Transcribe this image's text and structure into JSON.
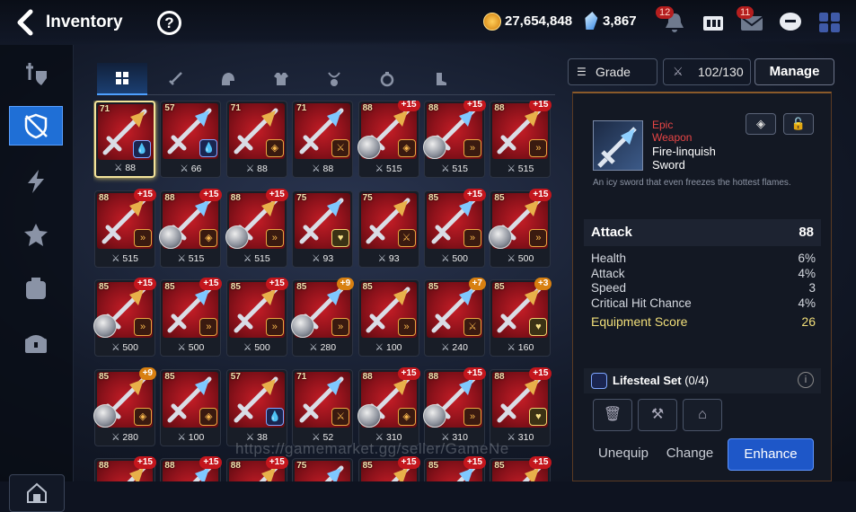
{
  "header": {
    "title": "Inventory",
    "help": "?",
    "gold": "27,654,848",
    "crystals": "3,867",
    "notif_badge": "12",
    "mail_badge": "11"
  },
  "sidebar": {
    "items": [
      "shield-slash-icon",
      "weapon-icon",
      "lightning-icon",
      "artifact-icon",
      "materials-icon",
      "chest-icon"
    ],
    "bottom": "house-icon"
  },
  "tabs": [
    "all",
    "weapon",
    "helmet",
    "armor",
    "necklace",
    "ring",
    "boots"
  ],
  "toolbar": {
    "grade": "Grade",
    "count": "102/130",
    "manage": "Manage"
  },
  "items": [
    [
      {
        "lvl": "71",
        "plus": "",
        "stat": "88",
        "set": "💧",
        "setc": "blue",
        "hero": false,
        "sel": true
      },
      {
        "lvl": "57",
        "plus": "",
        "stat": "66",
        "set": "💧",
        "setc": "blue",
        "hero": false
      },
      {
        "lvl": "71",
        "plus": "",
        "stat": "88",
        "set": "◈",
        "setc": "",
        "hero": false
      },
      {
        "lvl": "71",
        "plus": "",
        "stat": "88",
        "set": "⚔",
        "setc": "",
        "hero": false
      },
      {
        "lvl": "88",
        "plus": "+15",
        "stat": "515",
        "set": "◈",
        "setc": "",
        "hero": true
      },
      {
        "lvl": "88",
        "plus": "+15",
        "stat": "515",
        "set": "»",
        "setc": "",
        "hero": true
      },
      {
        "lvl": "88",
        "plus": "+15",
        "stat": "515",
        "set": "»",
        "setc": "",
        "hero": false
      }
    ],
    [
      {
        "lvl": "88",
        "plus": "+15",
        "stat": "515",
        "set": "»",
        "setc": "",
        "hero": false
      },
      {
        "lvl": "88",
        "plus": "+15",
        "stat": "515",
        "set": "◈",
        "setc": "",
        "hero": true
      },
      {
        "lvl": "88",
        "plus": "+15",
        "stat": "515",
        "set": "»",
        "setc": "",
        "hero": true
      },
      {
        "lvl": "75",
        "plus": "",
        "stat": "93",
        "set": "♥",
        "setc": "yel",
        "hero": false
      },
      {
        "lvl": "75",
        "plus": "",
        "stat": "93",
        "set": "⚔",
        "setc": "",
        "hero": false
      },
      {
        "lvl": "85",
        "plus": "+15",
        "stat": "500",
        "set": "»",
        "setc": "",
        "hero": false
      },
      {
        "lvl": "85",
        "plus": "+15",
        "stat": "500",
        "set": "»",
        "setc": "",
        "hero": true
      }
    ],
    [
      {
        "lvl": "85",
        "plus": "+15",
        "stat": "500",
        "set": "»",
        "setc": "",
        "hero": true
      },
      {
        "lvl": "85",
        "plus": "+15",
        "stat": "500",
        "set": "»",
        "setc": "",
        "hero": false
      },
      {
        "lvl": "85",
        "plus": "+15",
        "stat": "500",
        "set": "»",
        "setc": "",
        "hero": false
      },
      {
        "lvl": "85",
        "plus": "+9",
        "stat": "280",
        "set": "»",
        "setc": "",
        "hero": true,
        "gold": true
      },
      {
        "lvl": "85",
        "plus": "",
        "stat": "100",
        "set": "»",
        "setc": "",
        "hero": false
      },
      {
        "lvl": "85",
        "plus": "+7",
        "stat": "240",
        "set": "⚔",
        "setc": "",
        "hero": false,
        "gold": true
      },
      {
        "lvl": "85",
        "plus": "+3",
        "stat": "160",
        "set": "♥",
        "setc": "yel",
        "hero": false,
        "gold": true
      }
    ],
    [
      {
        "lvl": "85",
        "plus": "+9",
        "stat": "280",
        "set": "◈",
        "setc": "",
        "hero": true,
        "gold": true
      },
      {
        "lvl": "85",
        "plus": "",
        "stat": "100",
        "set": "◈",
        "setc": "",
        "hero": false
      },
      {
        "lvl": "57",
        "plus": "",
        "stat": "38",
        "set": "💧",
        "setc": "blue",
        "hero": false
      },
      {
        "lvl": "71",
        "plus": "",
        "stat": "52",
        "set": "⚔",
        "setc": "",
        "hero": false
      },
      {
        "lvl": "88",
        "plus": "+15",
        "stat": "310",
        "set": "◈",
        "setc": "",
        "hero": true
      },
      {
        "lvl": "88",
        "plus": "+15",
        "stat": "310",
        "set": "»",
        "setc": "",
        "hero": true
      },
      {
        "lvl": "88",
        "plus": "+15",
        "stat": "310",
        "set": "♥",
        "setc": "yel",
        "hero": false
      }
    ],
    [
      {
        "lvl": "88",
        "plus": "+15",
        "stat": "",
        "set": "",
        "setc": "",
        "hero": false
      },
      {
        "lvl": "88",
        "plus": "+15",
        "stat": "",
        "set": "",
        "setc": "",
        "hero": false
      },
      {
        "lvl": "88",
        "plus": "+15",
        "stat": "",
        "set": "",
        "setc": "",
        "hero": false
      },
      {
        "lvl": "75",
        "plus": "",
        "stat": "",
        "set": "",
        "setc": "",
        "hero": false
      },
      {
        "lvl": "85",
        "plus": "+15",
        "stat": "",
        "set": "",
        "setc": "",
        "hero": false
      },
      {
        "lvl": "85",
        "plus": "+15",
        "stat": "",
        "set": "",
        "setc": "",
        "hero": false
      },
      {
        "lvl": "85",
        "plus": "+15",
        "stat": "",
        "set": "",
        "setc": "",
        "hero": false
      }
    ]
  ],
  "detail": {
    "rarity": "Epic",
    "type": "Weapon",
    "name": "Fire-linquish Sword",
    "description": "An icy sword that even freezes the hottest flames.",
    "main_stat": {
      "label": "Attack",
      "value": "88"
    },
    "substats": [
      {
        "label": "Health",
        "value": "6%"
      },
      {
        "label": "Attack",
        "value": "4%"
      },
      {
        "label": "Speed",
        "value": "3"
      },
      {
        "label": "Critical Hit Chance",
        "value": "4%"
      }
    ],
    "score": {
      "label": "Equipment Score",
      "value": "26"
    },
    "set": {
      "name": "Lifesteal Set",
      "progress": "(0/4)"
    },
    "actions": {
      "unequip": "Unequip",
      "change": "Change",
      "enhance": "Enhance"
    }
  },
  "watermark": "https://gamemarket.gg/seller/GameNe"
}
